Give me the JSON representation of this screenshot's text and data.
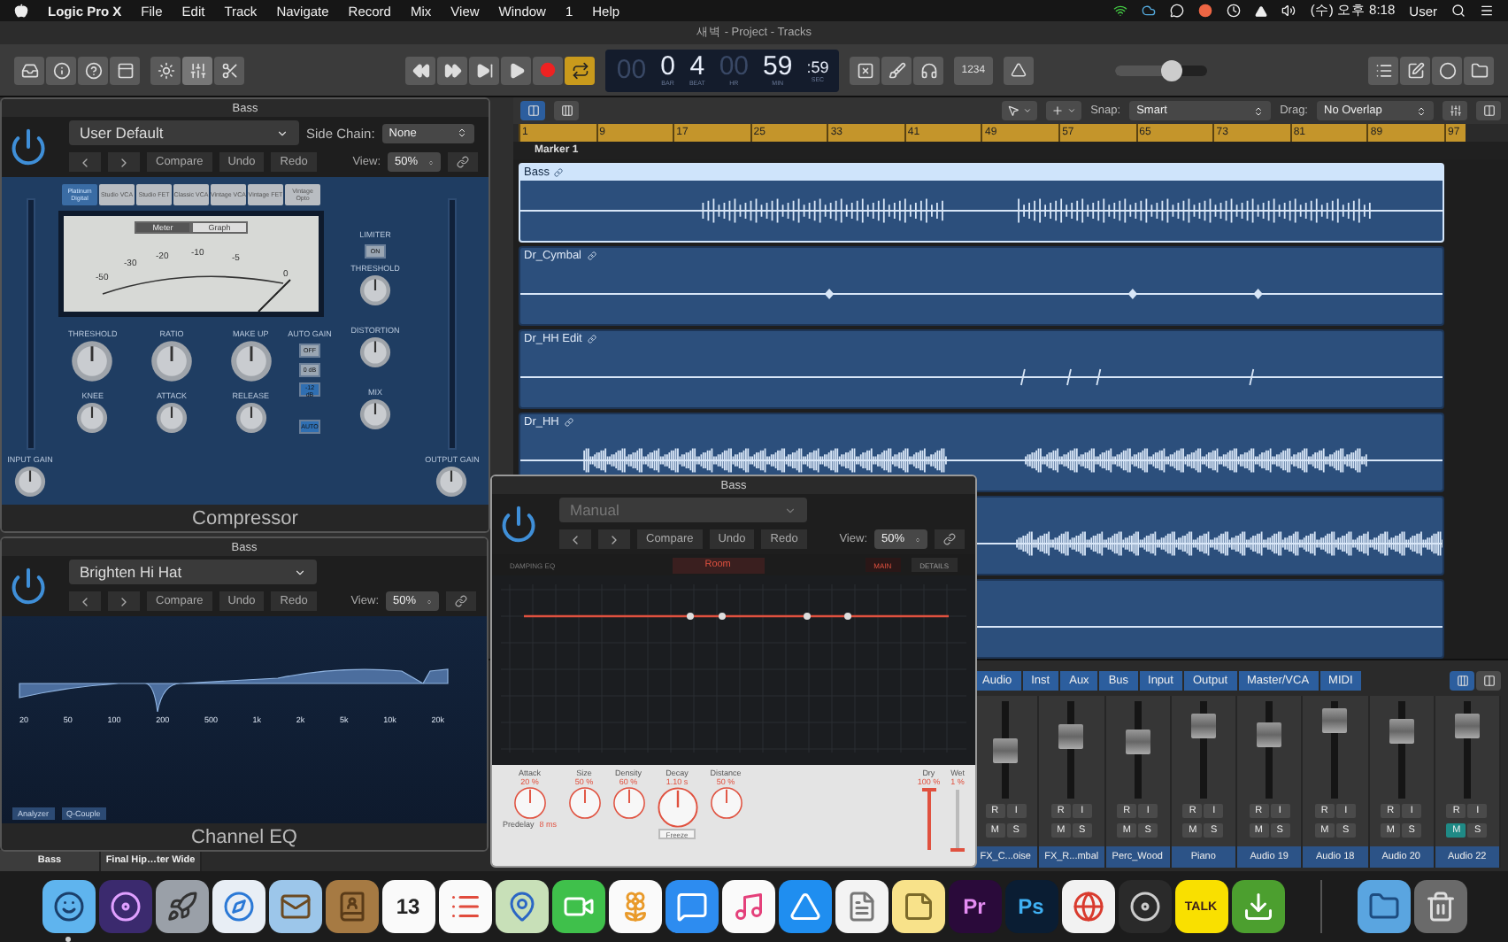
{
  "menu_bar": {
    "app": "Logic Pro X",
    "items": [
      "File",
      "Edit",
      "Track",
      "Navigate",
      "Record",
      "Mix",
      "View",
      "Window",
      "1",
      "Help"
    ],
    "clock": "(수) 오후 8:18",
    "user": "User"
  },
  "window": {
    "title": "새벽 - Project - Tracks"
  },
  "toolbar": {
    "cycle": true,
    "lcd": {
      "bar_lead": "00",
      "bar": "0",
      "beat": "4",
      "bar_label": "BAR",
      "beat_label": "BEAT",
      "hours": "00",
      "minutes": "59",
      "seconds": ":59",
      "hr_label": "HR",
      "min_label": "MIN",
      "sec_label": "SEC"
    },
    "count_in": "1234",
    "master_volume": {
      "level": 0.62
    }
  },
  "tracks_toolbar": {
    "snap_label": "Snap:",
    "snap": "Smart",
    "drag_label": "Drag:",
    "drag": "No Overlap"
  },
  "ruler": [
    "1",
    "9",
    "17",
    "25",
    "33",
    "41",
    "49",
    "57",
    "65",
    "73",
    "81",
    "89",
    "97"
  ],
  "marker": "Marker 1",
  "tracks": [
    {
      "name": "Bass",
      "selected": true,
      "kind": "dense"
    },
    {
      "name": "Dr_Cymbal",
      "selected": false,
      "kind": "hits"
    },
    {
      "name": "Dr_HH Edit",
      "selected": false,
      "kind": "ticks"
    },
    {
      "name": "Dr_HH",
      "selected": false,
      "kind": "noise"
    },
    {
      "selected": false,
      "kind": "noise"
    },
    {
      "selected": false,
      "kind": "hits"
    }
  ],
  "compressor": {
    "title": "Bass",
    "preset": "User Default",
    "side_chain_label": "Side Chain:",
    "side_chain": "None",
    "nav": [
      "Compare",
      "Undo",
      "Redo"
    ],
    "view_label": "View:",
    "view": "50%",
    "name": "Compressor",
    "models": [
      {
        "label": "Platinum Digital",
        "selected": true
      },
      {
        "label": "Studio VCA",
        "selected": false
      },
      {
        "label": "Studio FET",
        "selected": false
      },
      {
        "label": "Classic VCA",
        "selected": false
      },
      {
        "label": "Vintage VCA",
        "selected": false
      },
      {
        "label": "Vintage FET",
        "selected": false
      },
      {
        "label": "Vintage Opto",
        "selected": false
      }
    ],
    "meter_tabs": [
      {
        "label": "Meter",
        "selected": true
      },
      {
        "label": "Graph",
        "selected": false
      }
    ],
    "meter_scale": [
      "-50",
      "-30",
      "-20",
      "-10",
      "-5",
      "0"
    ],
    "main_knobs": [
      {
        "label": "THRESHOLD"
      },
      {
        "label": "RATIO"
      },
      {
        "label": "MAKE UP"
      },
      {
        "label": "KNEE"
      },
      {
        "label": "ATTACK"
      },
      {
        "label": "RELEASE"
      }
    ],
    "auto_gain": {
      "label": "AUTO GAIN",
      "options": [
        {
          "label": "OFF",
          "selected": false
        },
        {
          "label": "0 dB",
          "selected": false
        },
        {
          "label": "-12 dB",
          "selected": true
        }
      ],
      "auto": "AUTO"
    },
    "limiter": {
      "label": "LIMITER",
      "on": false,
      "button": "ON",
      "threshold": {
        "label": "THRESHOLD"
      }
    },
    "side_knobs": [
      {
        "label": "DISTORTION"
      },
      {
        "label": "MIX"
      }
    ],
    "input_gain": {
      "label": "INPUT GAIN"
    },
    "output_gain": {
      "label": "OUTPUT GAIN"
    }
  },
  "channel_eq": {
    "title": "Bass",
    "preset": "Brighten Hi Hat",
    "nav": [
      "Compare",
      "Undo",
      "Redo"
    ],
    "view_label": "View:",
    "view": "50%",
    "freqs": [
      "20",
      "50",
      "100",
      "200",
      "500",
      "1k",
      "2k",
      "5k",
      "10k",
      "20k"
    ],
    "buttons": [
      "Analyzer",
      "Q-Couple"
    ],
    "name": "Channel EQ"
  },
  "reverb": {
    "title": "Bass",
    "preset": "Manual",
    "nav": [
      "Compare",
      "Undo",
      "Redo"
    ],
    "view_label": "View:",
    "view": "50%",
    "damping": "DAMPING EQ",
    "room": "Room",
    "tabs": [
      {
        "label": "MAIN",
        "selected": true
      },
      {
        "label": "DETAILS",
        "selected": false
      }
    ],
    "knobs": [
      {
        "label": "Attack",
        "value": "20 %"
      },
      {
        "label": "Size",
        "value": "50 %"
      },
      {
        "label": "Density",
        "value": "60 %"
      },
      {
        "label": "Decay",
        "value": "1.10 s"
      },
      {
        "label": "Distance",
        "value": "50 %"
      }
    ],
    "predelay": {
      "label": "Predelay",
      "value": "8 ms"
    },
    "freeze": "Freeze",
    "faders": [
      {
        "label": "Dry",
        "value": "100 %",
        "level": 1
      },
      {
        "label": "Wet",
        "value": "1 %",
        "level": 0.01
      }
    ]
  },
  "mixer": {
    "inspector": [
      "Bass",
      "Final Hip…ter Wide"
    ],
    "tabs": [
      {
        "label": "Audio",
        "on": true
      },
      {
        "label": "Inst",
        "on": true
      },
      {
        "label": "Aux",
        "on": true
      },
      {
        "label": "Bus",
        "on": true
      },
      {
        "label": "Input",
        "on": true
      },
      {
        "label": "Output",
        "on": true
      },
      {
        "label": "Master/VCA",
        "on": true
      },
      {
        "label": "MIDI",
        "on": true
      }
    ],
    "strips": [
      {
        "name": "FX_C...oise",
        "level": 0.5,
        "muted": false,
        "labels": [
          "R",
          "I",
          "M",
          "S"
        ]
      },
      {
        "name": "FX_R...mbal",
        "level": 0.64,
        "muted": false,
        "labels": [
          "R",
          "I",
          "M",
          "S"
        ]
      },
      {
        "name": "Perc_Wood",
        "level": 0.58,
        "muted": false,
        "labels": [
          "R",
          "I",
          "M",
          "S"
        ]
      },
      {
        "name": "Piano",
        "level": 0.75,
        "muted": false,
        "labels": [
          "R",
          "I",
          "M",
          "S"
        ]
      },
      {
        "name": "Audio 19",
        "level": 0.66,
        "muted": false,
        "labels": [
          "R",
          "I",
          "M",
          "S"
        ]
      },
      {
        "name": "Audio 18",
        "level": 0.8,
        "muted": false,
        "labels": [
          "R",
          "I",
          "M",
          "S"
        ]
      },
      {
        "name": "Audio 20",
        "level": 0.7,
        "muted": false,
        "labels": [
          "R",
          "I",
          "M",
          "S"
        ]
      },
      {
        "name": "Audio 22",
        "level": 0.74,
        "muted": true,
        "labels": [
          "R",
          "I",
          "M",
          "S"
        ]
      }
    ]
  },
  "dock": [
    {
      "kind": "finder",
      "running": true
    },
    {
      "kind": "siri",
      "running": false
    },
    {
      "kind": "launchpad",
      "running": false
    },
    {
      "kind": "safari",
      "running": false
    },
    {
      "kind": "mail",
      "running": false
    },
    {
      "kind": "contacts",
      "running": false
    },
    {
      "kind": "calendar",
      "label": "13",
      "running": false
    },
    {
      "kind": "reminders",
      "running": false
    },
    {
      "kind": "maps",
      "running": false
    },
    {
      "kind": "facetime",
      "running": false
    },
    {
      "kind": "photos",
      "running": false
    },
    {
      "kind": "messages",
      "running": false
    },
    {
      "kind": "music",
      "running": false
    },
    {
      "kind": "appstore",
      "running": false
    },
    {
      "kind": "textedit",
      "running": false
    },
    {
      "kind": "notes",
      "running": false
    },
    {
      "kind": "premiere",
      "label": "Pr",
      "running": false
    },
    {
      "kind": "photoshop",
      "label": "Ps",
      "running": false
    },
    {
      "kind": "chrome",
      "running": false
    },
    {
      "kind": "disc",
      "running": false
    },
    {
      "kind": "kakaotalk",
      "label": "TALK",
      "running": false
    },
    {
      "kind": "torrent",
      "running": false
    },
    {
      "kind": "separator",
      "running": false
    },
    {
      "kind": "folder",
      "running": false
    },
    {
      "kind": "trash",
      "running": false
    }
  ]
}
